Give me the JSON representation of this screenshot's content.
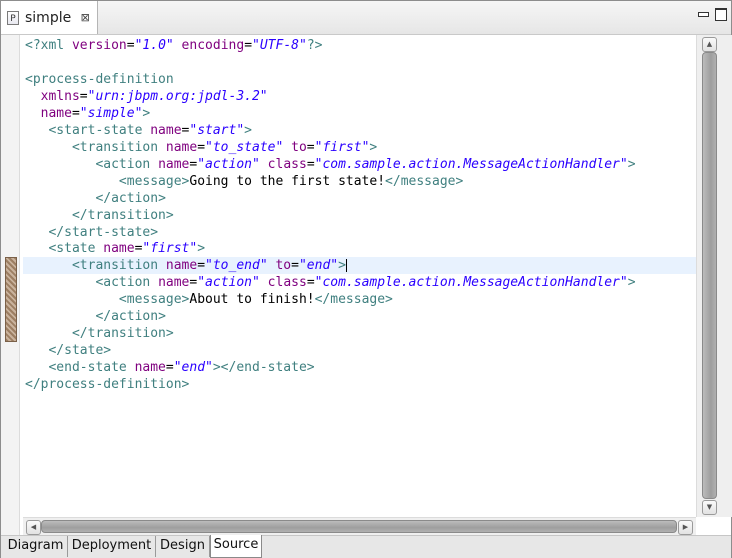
{
  "editor_tab": {
    "icon": "P",
    "title": "simple",
    "close": "⊠"
  },
  "code": {
    "line1": {
      "pi_open": "<?xml ",
      "a1": "version",
      "eq1": "=",
      "v1": "\"1.0\"",
      "a2": " encoding",
      "eq2": "=",
      "v2": "\"UTF-8\"",
      "pi_close": "?>"
    },
    "line3": {
      "tag": "<process-definition"
    },
    "line4": {
      "a": "xmlns",
      "eq": "=",
      "v": "\"urn:jbpm.org:jpdl-3.2\""
    },
    "line5": {
      "a": "name",
      "eq": "=",
      "v": "\"simple\"",
      "close": ">"
    },
    "line6": {
      "tag": "<start-state ",
      "a": "name",
      "eq": "=",
      "v": "\"start\"",
      "close": ">"
    },
    "line7": {
      "tag": "<transition ",
      "a1": "name",
      "eq1": "=",
      "v1": "\"to_state\"",
      "a2": " to",
      "eq2": "=",
      "v2": "\"first\"",
      "close": ">"
    },
    "line8": {
      "tag": "<action ",
      "a1": "name",
      "eq1": "=",
      "v1": "\"action\"",
      "a2": " class",
      "eq2": "=",
      "v2": "\"com.sample.action.MessageActionHandler\"",
      "close": ">"
    },
    "line9": {
      "open": "<message>",
      "text": "Going to the first state!",
      "close": "</message>"
    },
    "line10": {
      "tag": "</action>"
    },
    "line11": {
      "tag": "</transition>"
    },
    "line12": {
      "tag": "</start-state>"
    },
    "line13": {
      "tag": "<state ",
      "a": "name",
      "eq": "=",
      "v": "\"first\"",
      "close": ">"
    },
    "line14": {
      "tag": "<transition ",
      "a1": "name",
      "eq1": "=",
      "v1": "\"to_end\"",
      "a2": " to",
      "eq2": "=",
      "v2": "\"end\"",
      "close": ">"
    },
    "line15": {
      "tag": "<action ",
      "a1": "name",
      "eq1": "=",
      "v1": "\"action\"",
      "a2": " class",
      "eq2": "=",
      "v2": "\"com.sample.action.MessageActionHandler\"",
      "close": ">"
    },
    "line16": {
      "open": "<message>",
      "text": "About to finish!",
      "close": "</message>"
    },
    "line17": {
      "tag": "</action>"
    },
    "line18": {
      "tag": "</transition>"
    },
    "line19": {
      "tag": "</state>"
    },
    "line20": {
      "tag": "<end-state ",
      "a": "name",
      "eq": "=",
      "v": "\"end\"",
      "close": "></end-state>"
    },
    "line21": {
      "tag": "</process-definition>"
    }
  },
  "bottom_tabs": {
    "diagram": "Diagram",
    "deployment": "Deployment",
    "design": "Design",
    "source": "Source",
    "active": "Source"
  },
  "colors": {
    "tag": "#3f7f7f",
    "attr_name": "#7f007f",
    "attr_value": "#2a00ff",
    "current_line": "#e8f2fe"
  },
  "icons": {
    "file": "file-icon",
    "close": "close-icon",
    "minimize": "minimize-icon",
    "maximize": "maximize-icon"
  }
}
